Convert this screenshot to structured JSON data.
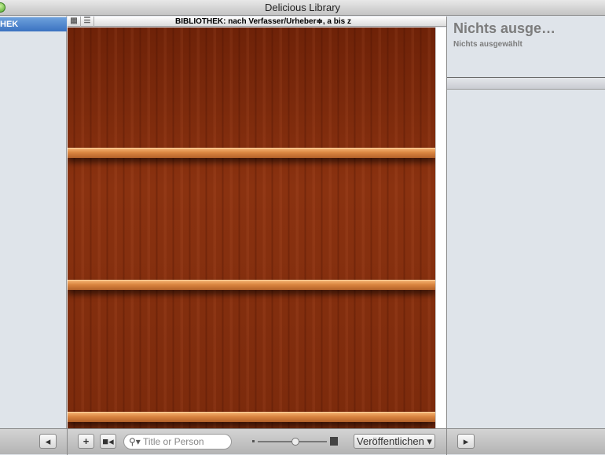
{
  "window": {
    "title": "Delicious Library"
  },
  "sidebar": {
    "selected_item": "HEK"
  },
  "center": {
    "header": "BIBLIOTHEK: nach Verfasser/Urheber≑, a bis z"
  },
  "right": {
    "title": "Nichts ausge…",
    "subtitle": "Nichts ausgewählt"
  },
  "toolbar": {
    "search_placeholder": "Title or Person",
    "publish_label": "Veröffentlichen ▾",
    "add_label": "+",
    "zoom_level": 0.55
  }
}
